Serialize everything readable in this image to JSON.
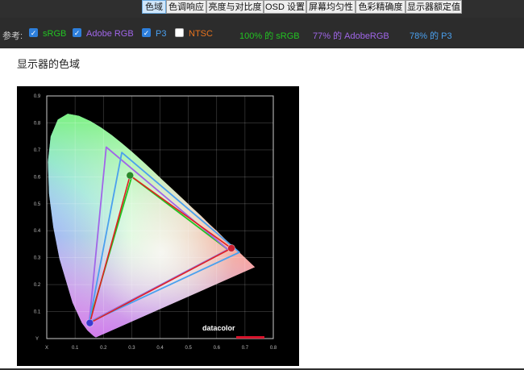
{
  "tabs": [
    {
      "label": "色域",
      "active": true
    },
    {
      "label": "色调响应",
      "active": false
    },
    {
      "label": "亮度与对比度",
      "active": false
    },
    {
      "label": "OSD 设置",
      "active": false
    },
    {
      "label": "屏幕均匀性",
      "active": false
    },
    {
      "label": "色彩精确度",
      "active": false
    },
    {
      "label": "显示器额定值",
      "active": false
    }
  ],
  "reference": {
    "label": "参考:",
    "items": [
      {
        "name": "sRGB",
        "checked": true,
        "color": "#22c322"
      },
      {
        "name": "Adobe RGB",
        "checked": true,
        "color": "#a066e8"
      },
      {
        "name": "P3",
        "checked": true,
        "color": "#4aa0ee"
      },
      {
        "name": "NTSC",
        "checked": false,
        "color": "#e8731e"
      }
    ],
    "stats": [
      {
        "text": "100% 的 sRGB",
        "color": "#22c322"
      },
      {
        "text": "77% 的 AdobeRGB",
        "color": "#a066e8"
      },
      {
        "text": "78% 的 P3",
        "color": "#4aa0ee"
      }
    ]
  },
  "section_title": "显示器的色域",
  "chart_data": {
    "type": "scatter",
    "xlim": [
      0,
      0.8
    ],
    "ylim": [
      0,
      0.9
    ],
    "x_ticks": [
      "X",
      "0.1",
      "0.2",
      "0.3",
      "0.4",
      "0.5",
      "0.6",
      "0.7",
      "0.8"
    ],
    "y_ticks": [
      "Y",
      "0.1",
      "0.2",
      "0.3",
      "0.4",
      "0.5",
      "0.6",
      "0.7",
      "0.8",
      "0.9"
    ],
    "grid": true,
    "series": [
      {
        "name": "sRGB",
        "color": "#22c322",
        "points": [
          [
            0.64,
            0.33
          ],
          [
            0.3,
            0.6
          ],
          [
            0.15,
            0.06
          ]
        ]
      },
      {
        "name": "Adobe RGB",
        "color": "#a066e8",
        "points": [
          [
            0.64,
            0.33
          ],
          [
            0.21,
            0.71
          ],
          [
            0.15,
            0.06
          ]
        ]
      },
      {
        "name": "P3",
        "color": "#4aa0ee",
        "points": [
          [
            0.68,
            0.32
          ],
          [
            0.265,
            0.69
          ],
          [
            0.15,
            0.06
          ]
        ]
      },
      {
        "name": "",
        "color": "#e02020",
        "points": [
          [
            0.652,
            0.335
          ],
          [
            0.294,
            0.605
          ],
          [
            0.152,
            0.058
          ]
        ]
      }
    ],
    "measured_primaries": [
      {
        "x": 0.652,
        "y": 0.335,
        "color": "#cc2233"
      },
      {
        "x": 0.294,
        "y": 0.605,
        "color": "#2a8a2a"
      },
      {
        "x": 0.152,
        "y": 0.058,
        "color": "#3a3ad0"
      }
    ],
    "logo_text": "datacolor"
  }
}
